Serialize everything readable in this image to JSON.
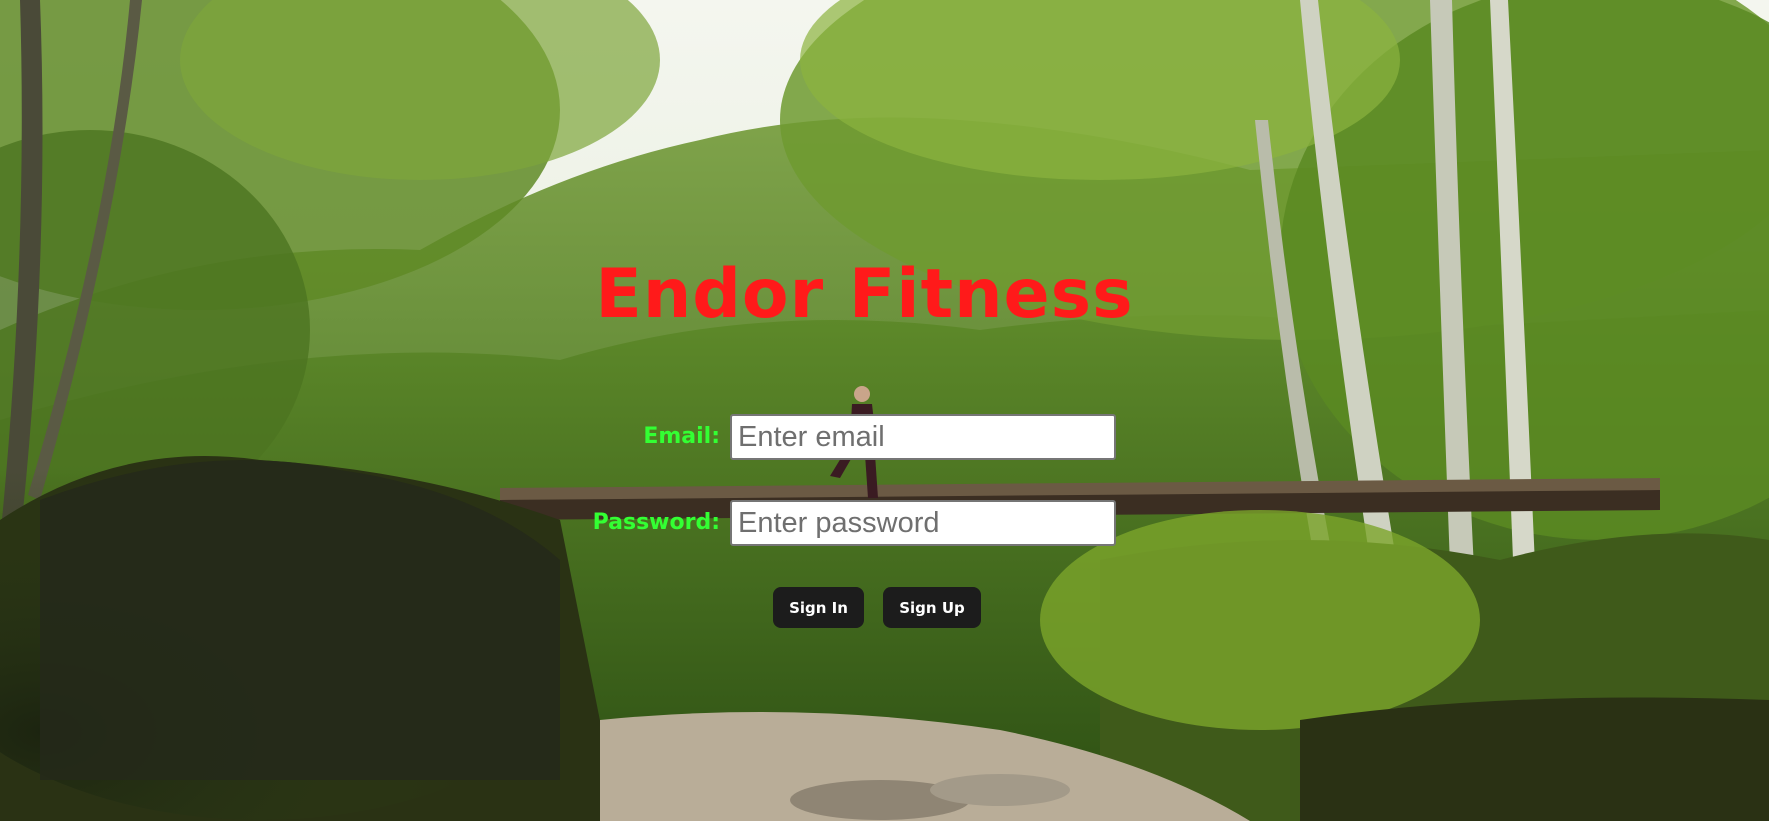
{
  "app": {
    "title": "Endor Fitness"
  },
  "form": {
    "email_label": "Email:",
    "email_placeholder": "Enter email",
    "email_value": "",
    "password_label": "Password:",
    "password_placeholder": "Enter password",
    "password_value": "",
    "signin_label": "Sign In",
    "signup_label": "Sign Up"
  },
  "background": {
    "description_icon": "forest-photo"
  },
  "colors": {
    "title": "#ff1a1a",
    "label": "#33ff33",
    "button_bg": "#1c1c1c",
    "button_text": "#ffffff",
    "input_bg": "#ffffff"
  }
}
